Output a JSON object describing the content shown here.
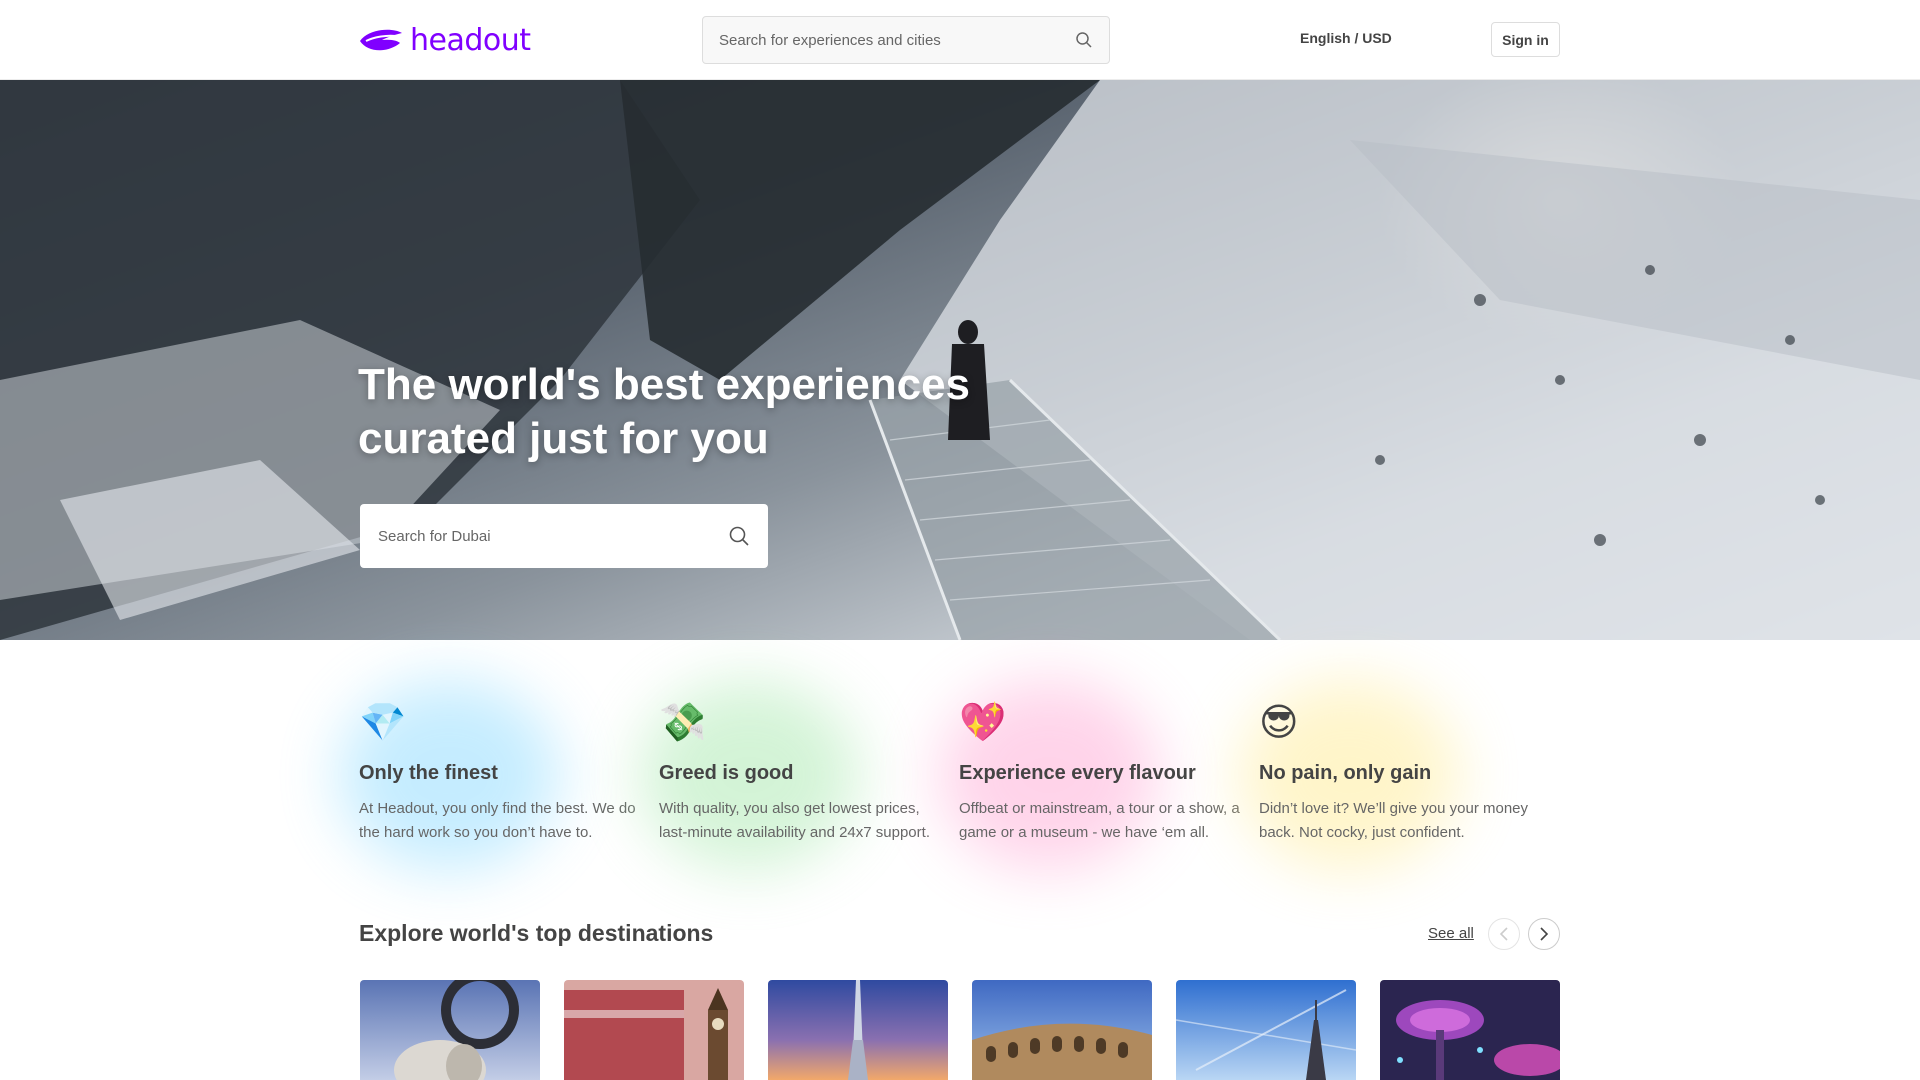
{
  "header": {
    "logo_text": "headout",
    "search_placeholder": "Search for experiences and cities",
    "language_currency": "English / USD",
    "signin_label": "Sign in"
  },
  "hero": {
    "title_line1": "The world's best experiences",
    "title_line2": "curated just for you",
    "search_placeholder": "Search for Dubai"
  },
  "features": [
    {
      "emoji": "💎",
      "title": "Only the finest",
      "desc": "At Headout, you only find the best. We do the hard work so you don’t have to.",
      "glow": "#7fd6ff"
    },
    {
      "emoji": "💸",
      "title": "Greed is good",
      "desc": "With quality, you also get lowest prices, last-minute availability and 24x7 support.",
      "glow": "#9fe6a6"
    },
    {
      "emoji": "💖",
      "title": "Experience every flavour",
      "desc": "Offbeat or mainstream, a tour or a show, a game or a museum - we have ‘em all.",
      "glow": "#ff9fd0"
    },
    {
      "emoji": "😎",
      "title": "No pain, only gain",
      "desc": "Didn’t love it? We’ll give you your money back. Not cocky, just confident.",
      "glow": "#ffe98a"
    }
  ],
  "destinations": {
    "title": "Explore world's top destinations",
    "see_all_label": "See all",
    "cards": [
      {
        "icon": "statue-image"
      },
      {
        "icon": "big-ben-image"
      },
      {
        "icon": "burj-khalifa-image"
      },
      {
        "icon": "colosseum-image"
      },
      {
        "icon": "eiffel-tower-image"
      },
      {
        "icon": "supertree-grove-image"
      }
    ]
  },
  "colors": {
    "brand": "#8000ff",
    "text": "#444444",
    "muted": "#666666"
  }
}
